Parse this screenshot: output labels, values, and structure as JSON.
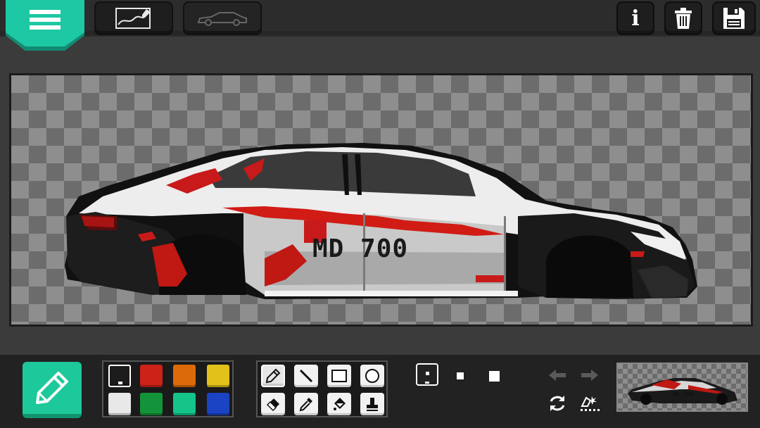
{
  "app": {
    "top_tabs": [
      {
        "name": "paint",
        "icon": "pencil-drawing-icon",
        "active": true
      },
      {
        "name": "car-outline",
        "icon": "car-silhouette-icon",
        "active": false
      }
    ],
    "top_actions": [
      {
        "name": "info",
        "icon": "info-icon",
        "glyph": "i"
      },
      {
        "name": "delete",
        "icon": "trash-icon"
      },
      {
        "name": "save",
        "icon": "floppy-disk-icon"
      }
    ]
  },
  "canvas": {
    "decal_text": "MD 700",
    "colors": {
      "checker_light": "#8e8e8e",
      "checker_dark": "#6c6c6c"
    }
  },
  "palette": {
    "colors": [
      "#1c1c1c",
      "#cc2218",
      "#dd6a0a",
      "#e2c21a",
      "#e8e8e8",
      "#14943a",
      "#14c488",
      "#1a44c4"
    ],
    "selected_index": 0
  },
  "tools": [
    {
      "name": "pencil",
      "icon": "pencil-icon",
      "active": true
    },
    {
      "name": "line",
      "icon": "line-icon",
      "active": false
    },
    {
      "name": "rectangle",
      "icon": "rectangle-icon",
      "active": false
    },
    {
      "name": "circle",
      "icon": "circle-icon",
      "active": false
    },
    {
      "name": "eraser",
      "icon": "eraser-icon",
      "active": false
    },
    {
      "name": "eyedropper",
      "icon": "eyedropper-icon",
      "active": false
    },
    {
      "name": "fill",
      "icon": "fill-icon",
      "active": false
    },
    {
      "name": "stamp",
      "icon": "stamp-icon",
      "active": false
    }
  ],
  "brush_sizes": [
    {
      "name": "small",
      "selected": true
    },
    {
      "name": "medium",
      "selected": false
    },
    {
      "name": "large",
      "selected": false
    }
  ],
  "controls": [
    {
      "name": "undo",
      "icon": "undo-icon",
      "enabled": false
    },
    {
      "name": "redo",
      "icon": "redo-icon",
      "enabled": false
    },
    {
      "name": "rotate",
      "icon": "rotate-icon",
      "enabled": true
    },
    {
      "name": "clear-pixels",
      "icon": "sparkle-erase-icon",
      "enabled": true
    }
  ],
  "preview": {
    "decal_text": "MD 700"
  },
  "accent": "#1dc89a"
}
